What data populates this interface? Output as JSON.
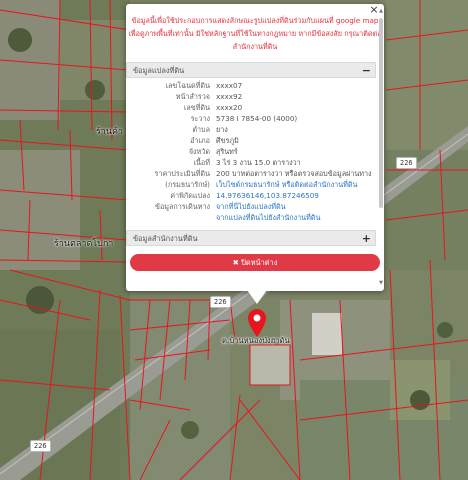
{
  "popup": {
    "close_label": "×",
    "notice": "ข้อมูลนี้เพื่อใช้ประกอบการแสดงลักษณะรูปแปลงที่ดินร่วมกับแผนที่ google map เพื่อดูภาพพื้นที่เท่านั้น มิใช่หลักฐานที่ใช้ในทางกฎหมาย หากมีข้อสงสัย กรุณาติดต่อสำนักงานที่ดิน",
    "section1_title": "ข้อมูลแปลงที่ดิน",
    "section1_toggle": "−",
    "rows": [
      {
        "k": "เลขโฉนดที่ดิน",
        "v": "xxxx07"
      },
      {
        "k": "หน้าสำรวจ",
        "v": "xxxx92"
      },
      {
        "k": "เลขที่ดิน",
        "v": "xxxx20"
      },
      {
        "k": "ระวาง",
        "v": "5738 I 7854-00 (4000)"
      },
      {
        "k": "ตำบล",
        "v": "ยาง"
      },
      {
        "k": "อำเภอ",
        "v": "ศีขรภูมิ"
      },
      {
        "k": "จังหวัด",
        "v": "สุรินทร์"
      },
      {
        "k": "เนื้อที่",
        "v": "3 ไร่ 3 งาน 15.0 ตารางวา"
      },
      {
        "k": "ราคาประเมินที่ดิน",
        "v": "200 บาทต่อตารางวา หรือตรวจสอบข้อมูลผ่านทาง"
      },
      {
        "k": "(กรมธนารักษ์)",
        "v": "เว็บไซต์กรมธนารักษ์ หรือติดต่อสำนักงานที่ดิน",
        "link": true
      },
      {
        "k": "ค่าพิกัดแปลง",
        "v": "14.97636146,103.87246509",
        "link": true
      },
      {
        "k": "ข้อมูลการเดินทาง",
        "v": "จากที่นี่ไปยังแปลงที่ดิน",
        "link": true
      },
      {
        "k": "",
        "v": "จากแปลงที่ดินไปยังสำนักงานที่ดิน",
        "link": true
      }
    ],
    "section2_title": "ข้อมูลสำนักงานที่ดิน",
    "section2_toggle": "+",
    "close_button": "✖ ปิดหน้าต่าง"
  },
  "map": {
    "marker_label": "ต.บ้านหนองป่งฮาดัน",
    "road_badges": [
      "226",
      "226",
      "226"
    ],
    "place_labels": [
      "ร้านค้า",
      "ร้านตลาดโปกา"
    ]
  },
  "colors": {
    "parcel_lines": "#e8141e",
    "marker": "#e8141e",
    "accent": "#e13a47"
  }
}
